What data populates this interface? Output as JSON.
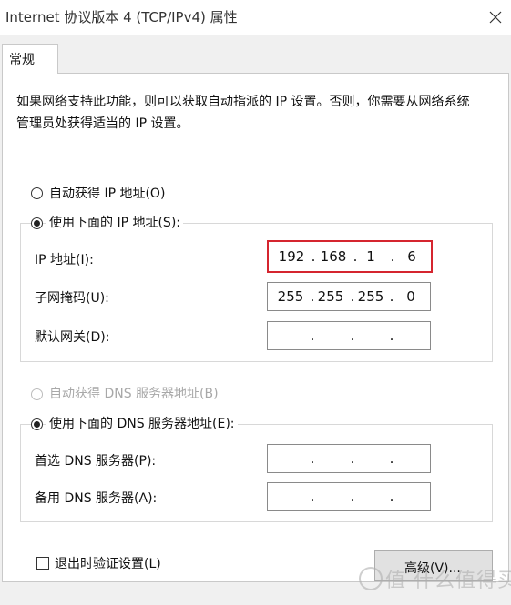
{
  "window": {
    "title": "Internet 协议版本 4 (TCP/IPv4) 属性",
    "close_symbol": "✕"
  },
  "tabs": [
    {
      "label": "常规",
      "selected": true
    }
  ],
  "general": {
    "description": "如果网络支持此功能，则可以获取自动指派的 IP 设置。否则，你需要从网络系统管理员处获得适当的 IP 设置。",
    "ip_mode": {
      "auto_label": "自动获得 IP 地址(O)",
      "manual_label": "使用下面的 IP 地址(S):",
      "selected": "manual"
    },
    "ip_fields": {
      "ip_label": "IP 地址(I):",
      "ip_octets": [
        "192",
        "168",
        "1",
        "6"
      ],
      "mask_label": "子网掩码(U):",
      "mask_octets": [
        "255",
        "255",
        "255",
        "0"
      ],
      "gateway_label": "默认网关(D):",
      "gateway_octets": [
        "",
        "",
        "",
        ""
      ]
    },
    "dns_mode": {
      "auto_label": "自动获得 DNS 服务器地址(B)",
      "auto_disabled": true,
      "manual_label": "使用下面的 DNS 服务器地址(E):",
      "selected": "manual"
    },
    "dns_fields": {
      "preferred_label": "首选 DNS 服务器(P):",
      "preferred_octets": [
        "",
        "",
        "",
        ""
      ],
      "alternate_label": "备用 DNS 服务器(A):",
      "alternate_octets": [
        "",
        "",
        "",
        ""
      ]
    },
    "validate_on_exit": {
      "label": "退出时验证设置(L)",
      "checked": false
    },
    "advanced_button": "高级(V)..."
  },
  "watermark": {
    "text": "值 什么值得买"
  },
  "colors": {
    "highlight_border": "#d5252f",
    "panel_background": "#ffffff",
    "dialog_background": "#f0f0f0"
  }
}
